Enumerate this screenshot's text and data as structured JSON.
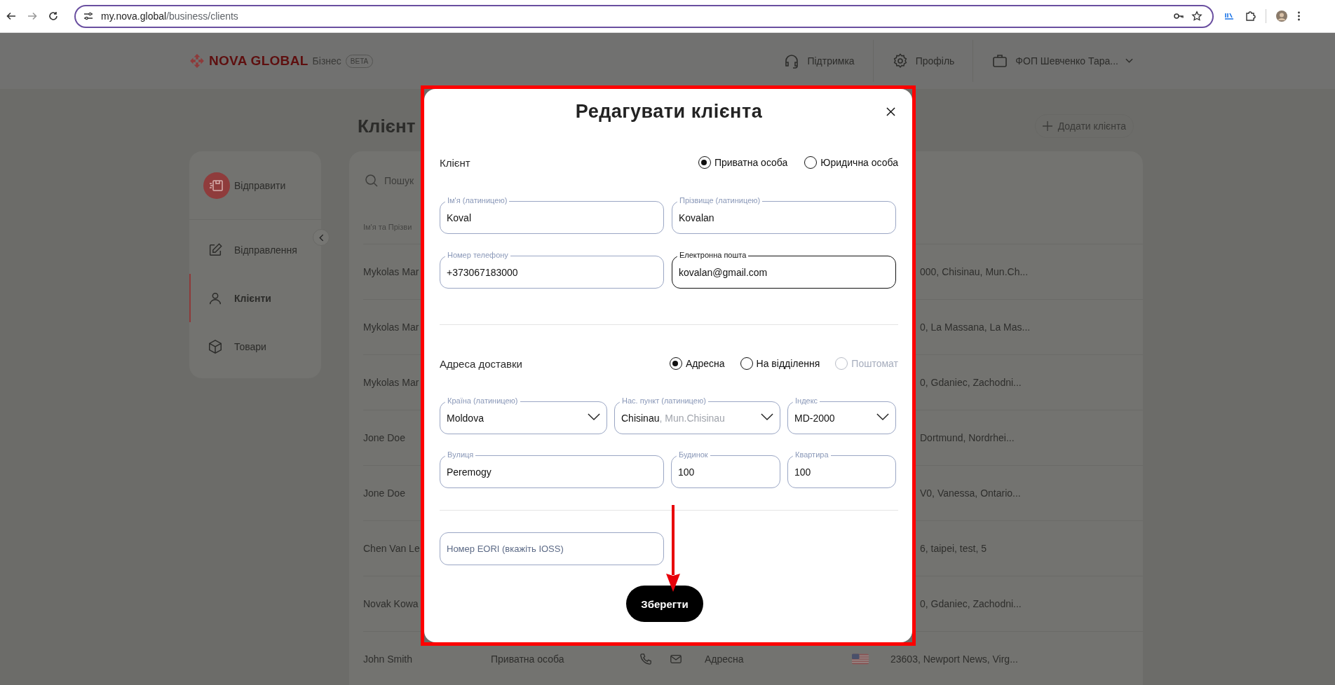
{
  "browser": {
    "url": {
      "host": "my.nova.global",
      "path": "/business/clients"
    }
  },
  "header": {
    "logo": {
      "name": "NOVA GLOBAL",
      "product": "Бізнес",
      "badge": "BETA"
    },
    "support": "Підтримка",
    "profile": "Профіль",
    "company": "ФОП Шевченко Тара..."
  },
  "sidebar": {
    "send": "Відправити",
    "items": [
      {
        "label": "Відправлення",
        "selected": false
      },
      {
        "label": "Клієнти",
        "selected": true
      },
      {
        "label": "Товари",
        "selected": false
      }
    ]
  },
  "page": {
    "title": "Клієнт",
    "add_button": "Додати клієнта"
  },
  "table": {
    "search_placeholder": "Пошук",
    "columns": [
      "Ім'я та Прізви"
    ],
    "rows": [
      {
        "kind": "covered",
        "name": "Mykolas Mar",
        "address": "000, Chisinau, Mun.Ch..."
      },
      {
        "kind": "covered",
        "name": "Mykolas Mar",
        "address": "0, La Massana, La Mas..."
      },
      {
        "kind": "covered",
        "name": "Mykolas Mar",
        "address": "0, Gdaniec, Zachodni..."
      },
      {
        "kind": "covered",
        "name": "Jone Doe",
        "address": "Dortmund, Nordrhei..."
      },
      {
        "kind": "covered",
        "name": "Jone Doe",
        "address": "V0, Vanessa, Ontario..."
      },
      {
        "kind": "covered",
        "name": "Chen Van Le",
        "address": "6, taipei, test, 5"
      },
      {
        "kind": "covered",
        "name": "Novak Kowa",
        "address": "0, Gdaniec, Zachodni..."
      },
      {
        "kind": "full",
        "name": "John Smith",
        "type": "Приватна особа",
        "delivery": "Адресна",
        "address": "23603, Newport News, Virg..."
      }
    ]
  },
  "modal": {
    "title": "Редагувати клієнта",
    "client": {
      "label": "Клієнт",
      "options": [
        {
          "label": "Приватна особа",
          "selected": true,
          "disabled": false
        },
        {
          "label": "Юридична особа",
          "selected": false,
          "disabled": false
        }
      ]
    },
    "personal_fields": [
      {
        "label": "Ім'я (латиницею)",
        "value": "Koval",
        "focused": false
      },
      {
        "label": "Прізвище (латиницею)",
        "value": "Kovalan",
        "focused": false
      },
      {
        "label": "Номер телефону",
        "value": "+373067183000",
        "focused": false
      },
      {
        "label": "Електронна пошта",
        "value": "kovalan@gmail.com",
        "focused": true
      }
    ],
    "delivery": {
      "label": "Адреса доставки",
      "options": [
        {
          "label": "Адресна",
          "selected": true,
          "disabled": false
        },
        {
          "label": "На відділення",
          "selected": false,
          "disabled": false
        },
        {
          "label": "Поштомат",
          "selected": false,
          "disabled": true
        }
      ]
    },
    "address_fields": [
      {
        "kind": "select",
        "label": "Країна (латиницею)",
        "value": "Moldova"
      },
      {
        "kind": "select",
        "label": "Нас. пункт (латиницею)",
        "value": "Chisinau",
        "detail": ", Mun.Chisinau"
      },
      {
        "kind": "select",
        "label": "Індекс",
        "value": "MD-2000"
      },
      {
        "kind": "text",
        "label": "Вулиця",
        "value": "Peremogy"
      },
      {
        "kind": "text",
        "label": "Будинок",
        "value": "100"
      },
      {
        "kind": "text",
        "label": "Квартира",
        "value": "100"
      }
    ],
    "eori": {
      "placeholder": "Номер EORI (вкажіть IOSS)"
    },
    "save_button": "Зберегти"
  }
}
